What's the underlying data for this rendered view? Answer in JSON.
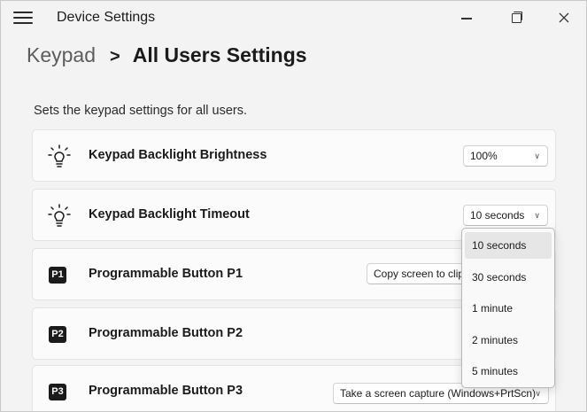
{
  "window": {
    "title": "Device Settings"
  },
  "breadcrumb": {
    "parent": "Keypad",
    "separator": ">",
    "current": "All Users Settings"
  },
  "description": "Sets the keypad settings for all users.",
  "settings": [
    {
      "icon": "lightbulb-icon",
      "label": "Keypad Backlight Brightness",
      "value": "100%"
    },
    {
      "icon": "lightbulb-icon",
      "label": "Keypad Backlight Timeout",
      "value": "10 seconds"
    },
    {
      "icon": "p1-badge-icon",
      "badge": "P1",
      "label": "Programmable Button P1",
      "value": "Copy screen to clip"
    },
    {
      "icon": "p2-badge-icon",
      "badge": "P2",
      "label": "Programmable Button P2",
      "value": ""
    },
    {
      "icon": "p3-badge-icon",
      "badge": "P3",
      "label": "Programmable Button P3",
      "value": "Take a screen capture (Windows+PrtScn)"
    }
  ],
  "timeout_dropdown": {
    "options": [
      "10 seconds",
      "30 seconds",
      "1 minute",
      "2 minutes",
      "5 minutes"
    ],
    "selected": "10 seconds"
  }
}
